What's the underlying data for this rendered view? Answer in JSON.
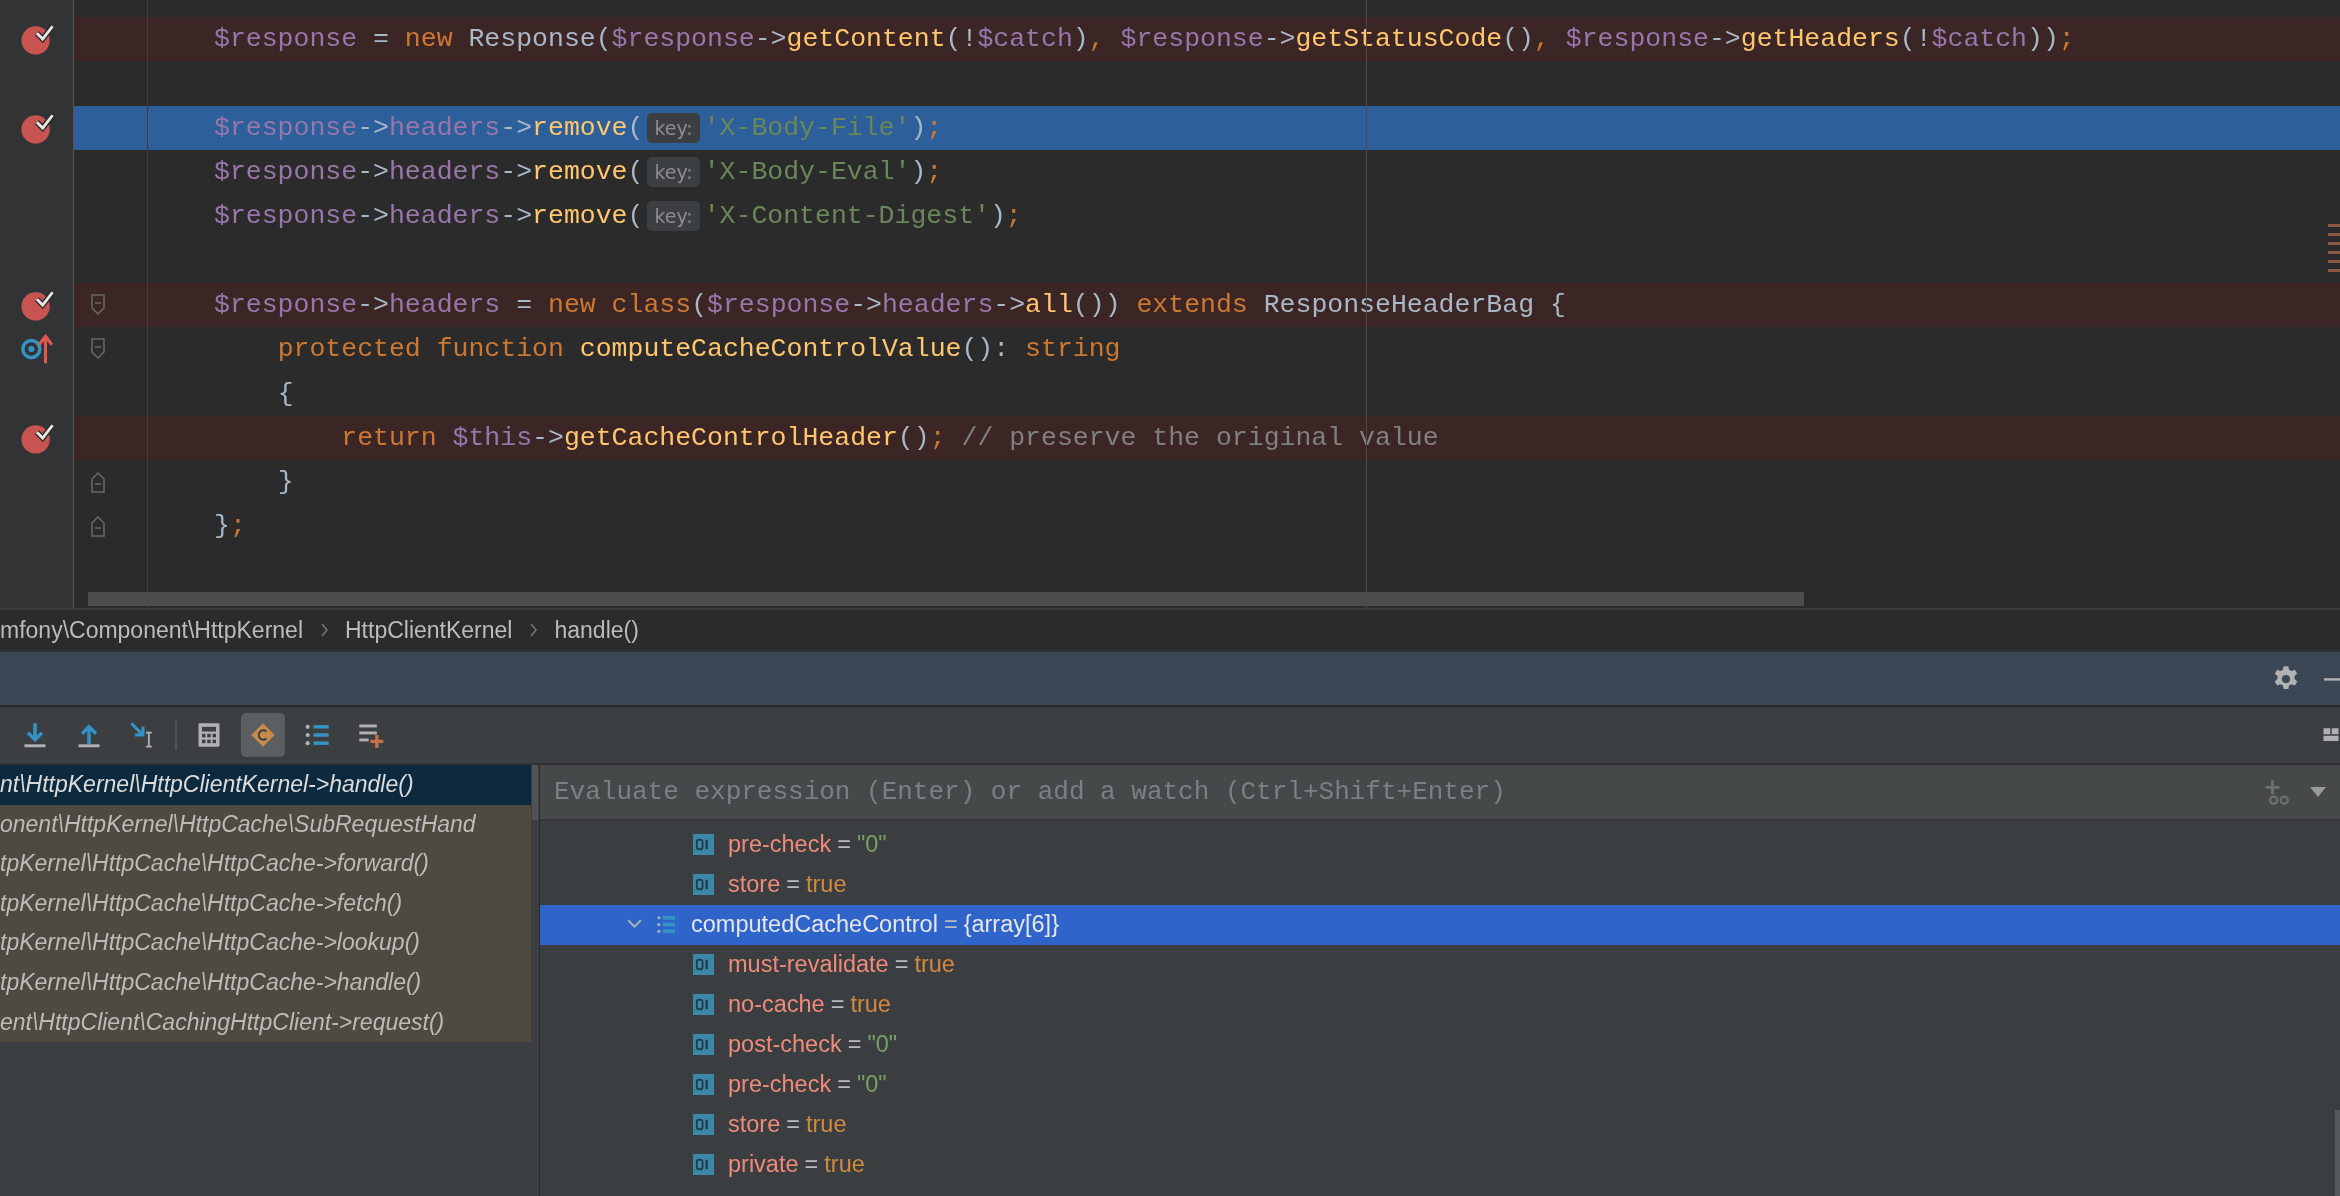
{
  "editor": {
    "lines": [
      {
        "kind": "code",
        "breakpoint": true,
        "tokens": [
          {
            "text": "$response",
            "kind": "var"
          },
          {
            "text": " = ",
            "kind": "plain"
          },
          {
            "text": "new ",
            "kind": "keyword"
          },
          {
            "text": "Response(",
            "kind": "plain"
          },
          {
            "text": "$response",
            "kind": "var"
          },
          {
            "text": "->",
            "kind": "plain"
          },
          {
            "text": "getContent",
            "kind": "func"
          },
          {
            "text": "(!",
            "kind": "plain"
          },
          {
            "text": "$catch",
            "kind": "var"
          },
          {
            "text": ")",
            "kind": "plain"
          },
          {
            "text": ", ",
            "kind": "punct"
          },
          {
            "text": "$response",
            "kind": "var"
          },
          {
            "text": "->",
            "kind": "plain"
          },
          {
            "text": "getStatusCode",
            "kind": "func"
          },
          {
            "text": "()",
            "kind": "plain"
          },
          {
            "text": ", ",
            "kind": "punct"
          },
          {
            "text": "$response",
            "kind": "var"
          },
          {
            "text": "->",
            "kind": "plain"
          },
          {
            "text": "getHeaders",
            "kind": "func"
          },
          {
            "text": "(!",
            "kind": "plain"
          },
          {
            "text": "$catch",
            "kind": "var"
          },
          {
            "text": "))",
            "kind": "plain"
          },
          {
            "text": ";",
            "kind": "punct"
          }
        ]
      },
      {
        "kind": "blank"
      },
      {
        "kind": "code",
        "breakpoint": true,
        "current": true,
        "tokens": [
          {
            "text": "$response",
            "kind": "var"
          },
          {
            "text": "->",
            "kind": "plain"
          },
          {
            "text": "headers",
            "kind": "var"
          },
          {
            "text": "->",
            "kind": "plain"
          },
          {
            "text": "remove",
            "kind": "func"
          },
          {
            "text": "(",
            "kind": "plain"
          },
          {
            "text": "key:",
            "kind": "hint"
          },
          {
            "text": "'X-Body-File'",
            "kind": "string"
          },
          {
            "text": ")",
            "kind": "plain"
          },
          {
            "text": ";",
            "kind": "punct"
          }
        ]
      },
      {
        "kind": "code",
        "tokens": [
          {
            "text": "$response",
            "kind": "var"
          },
          {
            "text": "->",
            "kind": "plain"
          },
          {
            "text": "headers",
            "kind": "var"
          },
          {
            "text": "->",
            "kind": "plain"
          },
          {
            "text": "remove",
            "kind": "func"
          },
          {
            "text": "(",
            "kind": "plain"
          },
          {
            "text": "key:",
            "kind": "hint"
          },
          {
            "text": "'X-Body-Eval'",
            "kind": "string"
          },
          {
            "text": ")",
            "kind": "plain"
          },
          {
            "text": ";",
            "kind": "punct"
          }
        ]
      },
      {
        "kind": "code",
        "tokens": [
          {
            "text": "$response",
            "kind": "var"
          },
          {
            "text": "->",
            "kind": "plain"
          },
          {
            "text": "headers",
            "kind": "var"
          },
          {
            "text": "->",
            "kind": "plain"
          },
          {
            "text": "remove",
            "kind": "func"
          },
          {
            "text": "(",
            "kind": "plain"
          },
          {
            "text": "key:",
            "kind": "hint"
          },
          {
            "text": "'X-Content-Digest'",
            "kind": "string"
          },
          {
            "text": ")",
            "kind": "plain"
          },
          {
            "text": ";",
            "kind": "punct"
          }
        ]
      },
      {
        "kind": "blank"
      },
      {
        "kind": "code",
        "breakpoint": true,
        "fold_start": true,
        "tokens": [
          {
            "text": "$response",
            "kind": "var"
          },
          {
            "text": "->",
            "kind": "plain"
          },
          {
            "text": "headers",
            "kind": "var"
          },
          {
            "text": " = ",
            "kind": "plain"
          },
          {
            "text": "new ",
            "kind": "keyword"
          },
          {
            "text": "class",
            "kind": "keyword"
          },
          {
            "text": "(",
            "kind": "plain"
          },
          {
            "text": "$response",
            "kind": "var"
          },
          {
            "text": "->",
            "kind": "plain"
          },
          {
            "text": "headers",
            "kind": "var"
          },
          {
            "text": "->",
            "kind": "plain"
          },
          {
            "text": "all",
            "kind": "func"
          },
          {
            "text": "()) ",
            "kind": "plain"
          },
          {
            "text": "extends",
            "kind": "keyword"
          },
          {
            "text": " ResponseHeaderBag {",
            "kind": "plain"
          }
        ]
      },
      {
        "kind": "code",
        "method_breakpoint": true,
        "fold_start": true,
        "tokens": [
          {
            "text": "    protected function ",
            "kind": "keyword"
          },
          {
            "text": "computeCacheControlValue",
            "kind": "func"
          },
          {
            "text": "(): ",
            "kind": "plain"
          },
          {
            "text": "string",
            "kind": "keyword"
          }
        ]
      },
      {
        "kind": "code",
        "tokens": [
          {
            "text": "    {",
            "kind": "plain"
          }
        ]
      },
      {
        "kind": "code",
        "breakpoint": true,
        "tokens": [
          {
            "text": "        return ",
            "kind": "keyword"
          },
          {
            "text": "$this",
            "kind": "var"
          },
          {
            "text": "->",
            "kind": "plain"
          },
          {
            "text": "getCacheControlHeader",
            "kind": "func"
          },
          {
            "text": "()",
            "kind": "plain"
          },
          {
            "text": ";",
            "kind": "punct"
          },
          {
            "text": " // preserve the original value",
            "kind": "comment"
          }
        ]
      },
      {
        "kind": "code",
        "fold_end": true,
        "tokens": [
          {
            "text": "    }",
            "kind": "plain"
          }
        ]
      },
      {
        "kind": "code",
        "fold_end": true,
        "tokens": [
          {
            "text": "}",
            "kind": "plain"
          },
          {
            "text": ";",
            "kind": "punct"
          }
        ]
      }
    ]
  },
  "breadcrumbs": [
    "mfony\\Component\\HttpKernel",
    "HttpClientKernel",
    "handle()"
  ],
  "toolbar": [
    {
      "kind": "step-into",
      "selected": false
    },
    {
      "kind": "step-out",
      "selected": false
    },
    {
      "kind": "run-to-cursor",
      "selected": false
    },
    {
      "kind": "separator"
    },
    {
      "kind": "evaluate",
      "selected": false
    },
    {
      "kind": "show-values",
      "selected": true
    },
    {
      "kind": "numbered-list",
      "selected": false
    },
    {
      "kind": "add-watch",
      "selected": false
    }
  ],
  "frames": [
    {
      "text": "nt\\HttpKernel\\HttpClientKernel->handle()",
      "selected": true,
      "library": false
    },
    {
      "text": "onent\\HttpKernel\\HttpCache\\SubRequestHand",
      "selected": false,
      "library": true
    },
    {
      "text": "tpKernel\\HttpCache\\HttpCache->forward()",
      "selected": false,
      "library": true
    },
    {
      "text": "tpKernel\\HttpCache\\HttpCache->fetch()",
      "selected": false,
      "library": true
    },
    {
      "text": "tpKernel\\HttpCache\\HttpCache->lookup()",
      "selected": false,
      "library": true
    },
    {
      "text": "tpKernel\\HttpCache\\HttpCache->handle()",
      "selected": false,
      "library": true
    },
    {
      "text": "ent\\HttpClient\\CachingHttpClient->request()",
      "selected": false,
      "library": true
    }
  ],
  "watch_field": {
    "placeholder": "Evaluate expression (Enter) or add a watch (Ctrl+Shift+Enter)"
  },
  "variables": [
    {
      "expanded": true,
      "children": [
        {
          "name": "pre-check",
          "sep": "=",
          "value": "\"0\"",
          "kind": "string",
          "selected": false
        },
        {
          "name": "store",
          "sep": "=",
          "value": "true",
          "kind": "bool",
          "selected": false
        }
      ]
    },
    {
      "name": "computedCacheControl",
      "sep": "=",
      "value": "{array[6]}",
      "kind": "array",
      "selected": true,
      "expanded": true,
      "children": [
        {
          "name": "must-revalidate",
          "sep": "=",
          "value": "true",
          "kind": "bool",
          "selected": false
        },
        {
          "name": "no-cache",
          "sep": "=",
          "value": "true",
          "kind": "bool",
          "selected": false
        },
        {
          "name": "post-check",
          "sep": "=",
          "value": "\"0\"",
          "kind": "string",
          "selected": false
        },
        {
          "name": "pre-check",
          "sep": "=",
          "value": "\"0\"",
          "kind": "string",
          "selected": false
        },
        {
          "name": "store",
          "sep": "=",
          "value": "true",
          "kind": "bool",
          "selected": false
        },
        {
          "name": "private",
          "sep": "=",
          "value": "true",
          "kind": "bool",
          "selected": false
        }
      ]
    }
  ]
}
